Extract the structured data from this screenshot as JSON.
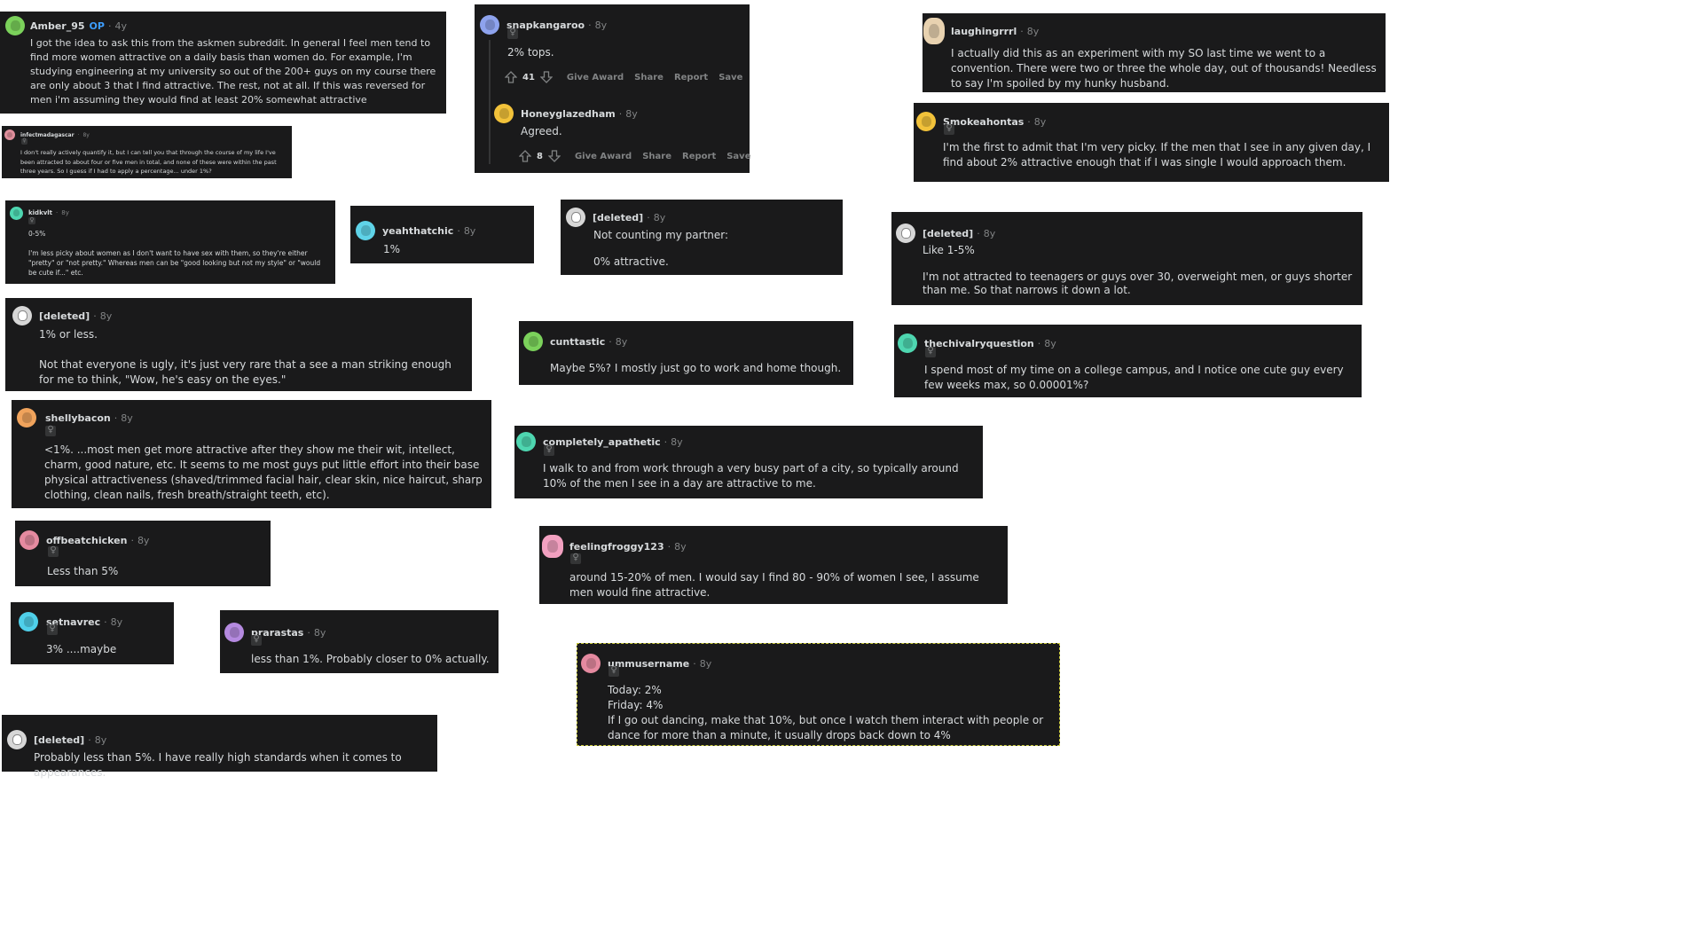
{
  "comments": [
    {
      "id": "amber",
      "username": "Amber_95",
      "op": "OP",
      "time": "4y",
      "flair": "",
      "avatar_color": "#7bd15b",
      "text": "I got the idea to ask this from the askmen subreddit. In general I feel men tend to find more women attractive on a daily basis than women do. For example, I'm studying engineering at my university so out of the 200+ guys on my course there are only about 3 that I find attractive. The rest, not at all. If this was reversed for men i'm assuming they would find at least 20% somewhat attractive"
    },
    {
      "id": "infect",
      "username": "infectmadagascar",
      "time": "8y",
      "flair": "♀",
      "avatar_color": "#e08f9c",
      "text": "I don't really actively quantify it, but I can tell you that through the course of my life I've been attracted to about four or five men in total, and none of these were within the past three years. So I guess if I had to apply a percentage... under 1%?"
    },
    {
      "id": "kidkvlt",
      "username": "kidkvlt",
      "time": "8y",
      "flair": "♀",
      "avatar_color": "#4ed6b0",
      "text": "0-5%\n\nI'm less picky about women as I don't want to have sex with them, so they're either \"pretty\" or \"not pretty.\" Whereas men can be \"good looking but not my style\" or \"would be cute if...\" etc."
    },
    {
      "id": "yeah",
      "username": "yeahthatchic",
      "time": "8y",
      "flair": "",
      "avatar_color": "#5fd3e8",
      "text": "1%"
    },
    {
      "id": "del1",
      "username": "[deleted]",
      "time": "8y",
      "flair": "",
      "avatar_color": "#d7d7d7",
      "text": "1% or less.\n\nNot that everyone is ugly, it's just very rare that a see a man striking enough for me to think, \"Wow, he's easy on the eyes.\""
    },
    {
      "id": "shelly",
      "username": "shellybacon",
      "time": "8y",
      "flair": "♀",
      "avatar_color": "#f0a35c",
      "text": "<1%. ...most men get more attractive after they show me their wit, intellect, charm, good nature, etc. It seems to me most guys put little effort into their base physical attractiveness (shaved/trimmed facial hair, clear skin, nice haircut, sharp clothing, clean nails, fresh breath/straight teeth, etc)."
    },
    {
      "id": "offbeat",
      "username": "offbeatchicken",
      "time": "8y",
      "flair": "♀",
      "avatar_color": "#e58aa0",
      "text": "Less than 5%"
    },
    {
      "id": "setna",
      "username": "setnavrec",
      "time": "8y",
      "flair": "♀",
      "avatar_color": "#4fd0ea",
      "text": "3% ....maybe"
    },
    {
      "id": "prara",
      "username": "prarastas",
      "time": "8y",
      "flair": "♀",
      "avatar_color": "#b58ae0",
      "text": "less than 1%. Probably closer to 0% actually."
    },
    {
      "id": "del5",
      "username": "[deleted]",
      "time": "8y",
      "flair": "",
      "avatar_color": "#d7d7d7",
      "text": "Probably less than 5%. I have really high standards when it comes to appearances."
    },
    {
      "id": "snap",
      "username": "snapkangaroo",
      "time": "8y",
      "flair": "♀",
      "avatar_color": "#8ea3ee",
      "text": "2% tops.",
      "votes": "41",
      "give_award": "Give Award",
      "share": "Share",
      "report": "Report",
      "save": "Save"
    },
    {
      "id": "honey",
      "username": "Honeyglazedham",
      "time": "8y",
      "flair": "",
      "avatar_color": "#f2c23a",
      "text": "Agreed.",
      "votes": "8",
      "give_award": "Give Award",
      "share": "Share",
      "report": "Report",
      "save": "Save"
    },
    {
      "id": "del2",
      "username": "[deleted]",
      "time": "8y",
      "flair": "",
      "avatar_color": "#d7d7d7",
      "text": "Not counting my partner:\n\n0% attractive."
    },
    {
      "id": "cunt",
      "username": "cunttastic",
      "time": "8y",
      "flair": "",
      "avatar_color": "#7bd15b",
      "text": "Maybe 5%? I mostly just go to work and home though."
    },
    {
      "id": "comp",
      "username": "completely_apathetic",
      "time": "8y",
      "flair": "♀",
      "avatar_color": "#4ed6b0",
      "text": "I walk to and from work through a very busy part of a city, so typically around 10% of the men I see in a day are attractive to me."
    },
    {
      "id": "frog",
      "username": "feelingfroggy123",
      "time": "8y",
      "flair": "♀",
      "avatar_color": "#f2a0c0",
      "text": "around 15-20% of men. I would say I find 80 - 90% of women I see, I assume men would fine attractive."
    },
    {
      "id": "umm",
      "username": "ummusername",
      "time": "8y",
      "flair": "♀",
      "avatar_color": "#e58aa0",
      "text": "Today: 2%\nFriday: 4%\nIf I go out dancing, make that 10%, but once I watch them interact with people or dance for more than a minute, it usually drops back down to 4%"
    },
    {
      "id": "laugh",
      "username": "laughingrrrl",
      "time": "8y",
      "flair": "",
      "avatar_color": "#e8d2b0",
      "text": "I actually did this as an experiment with my SO last time we went to a convention. There were two or three the whole day, out of thousands! Needless to say I'm spoiled by my hunky husband."
    },
    {
      "id": "smoke",
      "username": "Smokeahontas",
      "time": "8y",
      "flair": "♀",
      "avatar_color": "#f2c23a",
      "text": "I'm the first to admit that I'm very picky. If the men that I see in any given day, I find about 2% attractive enough that if I was single I would approach them."
    },
    {
      "id": "del3",
      "username": "[deleted]",
      "time": "8y",
      "flair": "",
      "avatar_color": "#d7d7d7",
      "text": "Like 1-5%\n\nI'm not attracted to teenagers or guys over 30, overweight men, or guys shorter than me. So that narrows it down a lot."
    },
    {
      "id": "chiv",
      "username": "thechivalryquestion",
      "time": "8y",
      "flair": "♀",
      "avatar_color": "#4ed6b0",
      "text": "I spend most of my time on a college campus, and I notice one cute guy every few weeks max, so 0.00001%?"
    }
  ]
}
